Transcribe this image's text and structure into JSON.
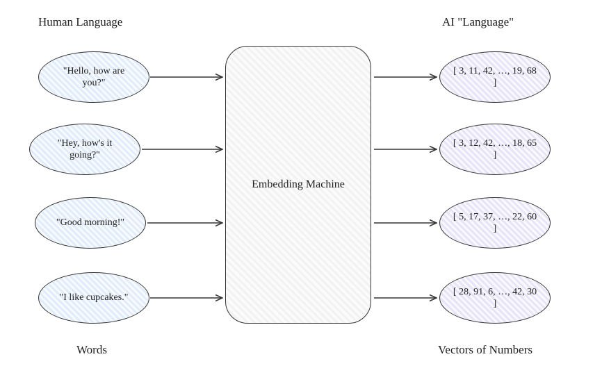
{
  "headings": {
    "left_top": "Human Language",
    "right_top": "AI \"Language\"",
    "left_bottom": "Words",
    "right_bottom": "Vectors of Numbers"
  },
  "machine_label": "Embedding Machine",
  "inputs": [
    "\"Hello, how are you?\"",
    "\"Hey, how's it going?\"",
    "\"Good morning!\"",
    "\"I like cupcakes.\""
  ],
  "outputs": [
    "[ 3, 11, 42, …, 19, 68 ]",
    "[ 3, 12, 42, …, 18, 65 ]",
    "[ 5, 17, 37, …, 22, 60 ]",
    "[ 28, 91, 6, …, 42, 30 ]"
  ]
}
